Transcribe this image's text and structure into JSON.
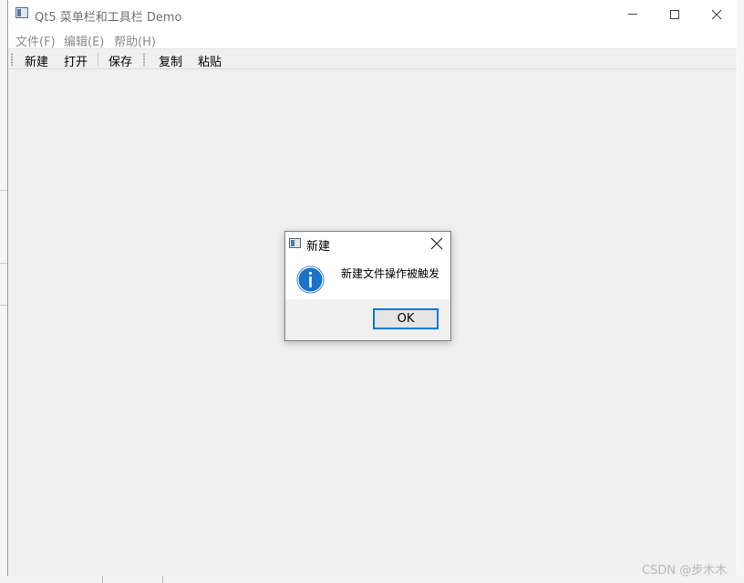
{
  "window": {
    "title": "Qt5 菜单栏和工具栏 Demo",
    "controls": {
      "minimize": "minimize-icon",
      "maximize": "maximize-icon",
      "close": "close-icon"
    }
  },
  "menubar": {
    "items": [
      {
        "label": "文件(F)"
      },
      {
        "label": "编辑(E)"
      },
      {
        "label": "帮助(H)"
      }
    ]
  },
  "toolbar": {
    "buttons": [
      {
        "label": "新建"
      },
      {
        "label": "打开"
      },
      {
        "label": "保存"
      },
      {
        "label": "复制"
      },
      {
        "label": "粘贴"
      }
    ]
  },
  "dialog": {
    "title": "新建",
    "icon": "information-icon",
    "message": "新建文件操作被触发",
    "ok_label": "OK",
    "accent_color": "#0078d7"
  },
  "watermark": "CSDN @步木木"
}
